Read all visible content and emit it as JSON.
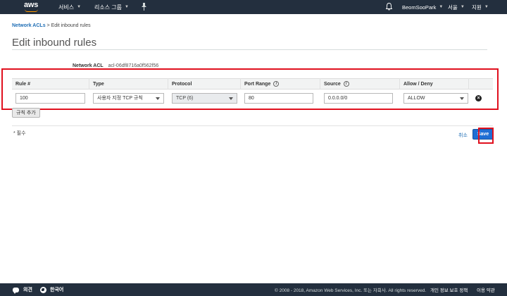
{
  "topnav": {
    "logo_text": "aws",
    "services_label": "서비스",
    "resource_groups_label": "리소스 그룹",
    "pin_icon": "pin-icon",
    "bell_icon": "bell-icon",
    "user_name": "BeomSooPark",
    "region_label": "서울",
    "support_label": "지원"
  },
  "breadcrumb": {
    "parent_label": "Network ACLs",
    "separator": ">",
    "current_label": "Edit inbound rules"
  },
  "page": {
    "title": "Edit inbound rules",
    "acl_label": "Network ACL",
    "acl_id": "acl-06df8716a0f562f56"
  },
  "table": {
    "columns": [
      {
        "label": "Rule #",
        "info": false
      },
      {
        "label": "Type",
        "info": false
      },
      {
        "label": "Protocol",
        "info": false
      },
      {
        "label": "Port Range",
        "info": true
      },
      {
        "label": "Source",
        "info": true
      },
      {
        "label": "Allow / Deny",
        "info": false
      }
    ],
    "info_glyph": "i",
    "rows": [
      {
        "rule_number": "100",
        "type": "사용자 지정 TCP 규칙",
        "protocol": "TCP (6)",
        "port_range": "80",
        "source": "0.0.0.0/0",
        "allow_deny": "ALLOW",
        "remove_glyph": "×"
      }
    ]
  },
  "actions": {
    "add_rule_label": "규칙 추가",
    "required_note": "* 필수",
    "cancel_label": "취소",
    "save_label": "Save"
  },
  "footer": {
    "feedback_label": "의견",
    "language_label": "한국어",
    "copyright": "© 2008 - 2018, Amazon Web Services, Inc. 또는 자회사. All rights reserved.",
    "privacy_label": "개인 정보 보호 정책",
    "terms_label": "이용 약관"
  },
  "colors": {
    "topbar_bg": "#232f3e",
    "logo_accent": "#ff9900",
    "link": "#1f6eb5",
    "primary_button": "#1f6ed4",
    "highlight_border": "#e0101e"
  }
}
